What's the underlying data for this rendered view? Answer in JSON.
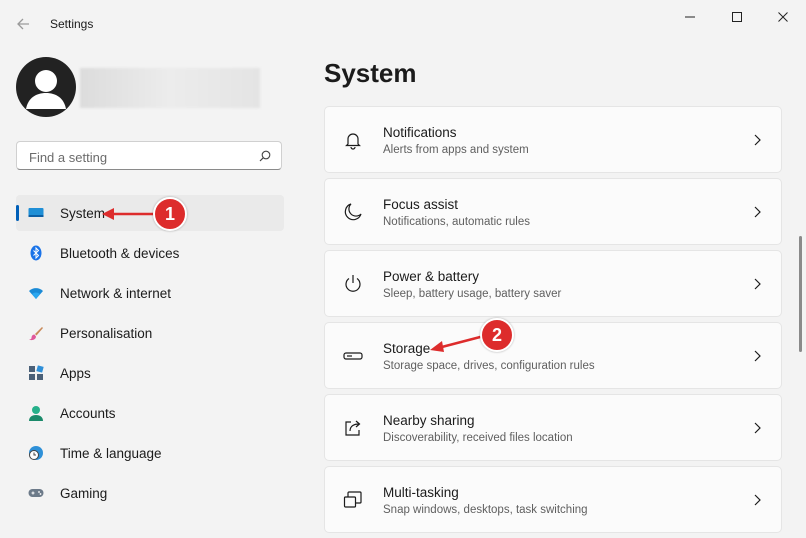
{
  "window": {
    "title": "Settings"
  },
  "search": {
    "placeholder": "Find a setting"
  },
  "sidebar": {
    "items": [
      {
        "label": "System",
        "selected": true
      },
      {
        "label": "Bluetooth & devices"
      },
      {
        "label": "Network & internet"
      },
      {
        "label": "Personalisation"
      },
      {
        "label": "Apps"
      },
      {
        "label": "Accounts"
      },
      {
        "label": "Time & language"
      },
      {
        "label": "Gaming"
      }
    ]
  },
  "main": {
    "title": "System",
    "cards": [
      {
        "title": "Notifications",
        "subtitle": "Alerts from apps and system",
        "icon": "bell-icon"
      },
      {
        "title": "Focus assist",
        "subtitle": "Notifications, automatic rules",
        "icon": "moon-icon"
      },
      {
        "title": "Power & battery",
        "subtitle": "Sleep, battery usage, battery saver",
        "icon": "power-icon"
      },
      {
        "title": "Storage",
        "subtitle": "Storage space, drives, configuration rules",
        "icon": "storage-icon"
      },
      {
        "title": "Nearby sharing",
        "subtitle": "Discoverability, received files location",
        "icon": "share-icon"
      },
      {
        "title": "Multi-tasking",
        "subtitle": "Snap windows, desktops, task switching",
        "icon": "multitask-icon"
      }
    ]
  },
  "annotations": [
    {
      "number": "1",
      "target": "System"
    },
    {
      "number": "2",
      "target": "Storage"
    }
  ],
  "colors": {
    "accent": "#005fb8",
    "annotation": "#dd2c2c",
    "background": "#f3f3f3"
  }
}
